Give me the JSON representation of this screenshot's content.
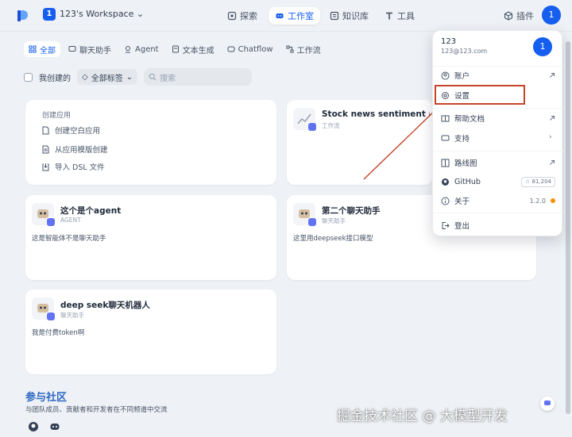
{
  "header": {
    "workspace_badge": "1",
    "workspace_name": "123's Workspace",
    "nav": [
      {
        "label": "探索",
        "icon": "explore-icon"
      },
      {
        "label": "工作室",
        "icon": "studio-icon"
      },
      {
        "label": "知识库",
        "icon": "knowledge-icon"
      },
      {
        "label": "工具",
        "icon": "tools-icon"
      }
    ],
    "plugins_label": "插件",
    "avatar_initial": "1"
  },
  "tabs": [
    {
      "label": "全部",
      "icon": "grid-icon"
    },
    {
      "label": "聊天助手",
      "icon": "chat-icon"
    },
    {
      "label": "Agent",
      "icon": "agent-icon"
    },
    {
      "label": "文本生成",
      "icon": "text-icon"
    },
    {
      "label": "Chatflow",
      "icon": "chatflow-icon"
    },
    {
      "label": "工作流",
      "icon": "workflow-icon"
    }
  ],
  "filters": {
    "my_created": "我创建的",
    "all_tags": "全部标签",
    "search_placeholder": "搜索"
  },
  "create_card": {
    "title": "创建应用",
    "items": [
      "创建空白应用",
      "从应用模版创建",
      "导入 DSL 文件"
    ]
  },
  "apps": [
    {
      "name": "Stock news sentiment analysis",
      "type": "工作流",
      "description": ""
    },
    {
      "name": "这个是个agent",
      "type": "AGENT",
      "description": "这是智能体不是聊天助手"
    },
    {
      "name": "第二个聊天助手",
      "type": "聊天助手",
      "description": "这里用deepseek接口模型"
    },
    {
      "name": "deep seek聊天机器人",
      "type": "聊天助手",
      "description": "我是付费token啊"
    }
  ],
  "community": {
    "title": "参与社区",
    "description": "与团队成员、贡献者和开发者在不同频道中交流"
  },
  "account_menu": {
    "name": "123",
    "email": "123@123.com",
    "avatar_initial": "1",
    "items": [
      {
        "label": "账户",
        "icon": "user-circle-icon"
      },
      {
        "label": "设置",
        "icon": "settings-icon"
      },
      {
        "label": "帮助文档",
        "icon": "book-icon"
      },
      {
        "label": "支持",
        "icon": "support-icon"
      },
      {
        "label": "路线图",
        "icon": "roadmap-icon"
      },
      {
        "label": "GitHub",
        "icon": "github-icon",
        "badge": "☆ 81,204"
      },
      {
        "label": "关于",
        "icon": "info-icon",
        "version": "1.2.0"
      },
      {
        "label": "登出",
        "icon": "logout-icon"
      }
    ]
  },
  "watermark": "掘金技术社区 @ 大模型开发",
  "colors": {
    "accent": "#155EEF",
    "annotation": "#C6432B",
    "community_title": "#2D68C4"
  }
}
